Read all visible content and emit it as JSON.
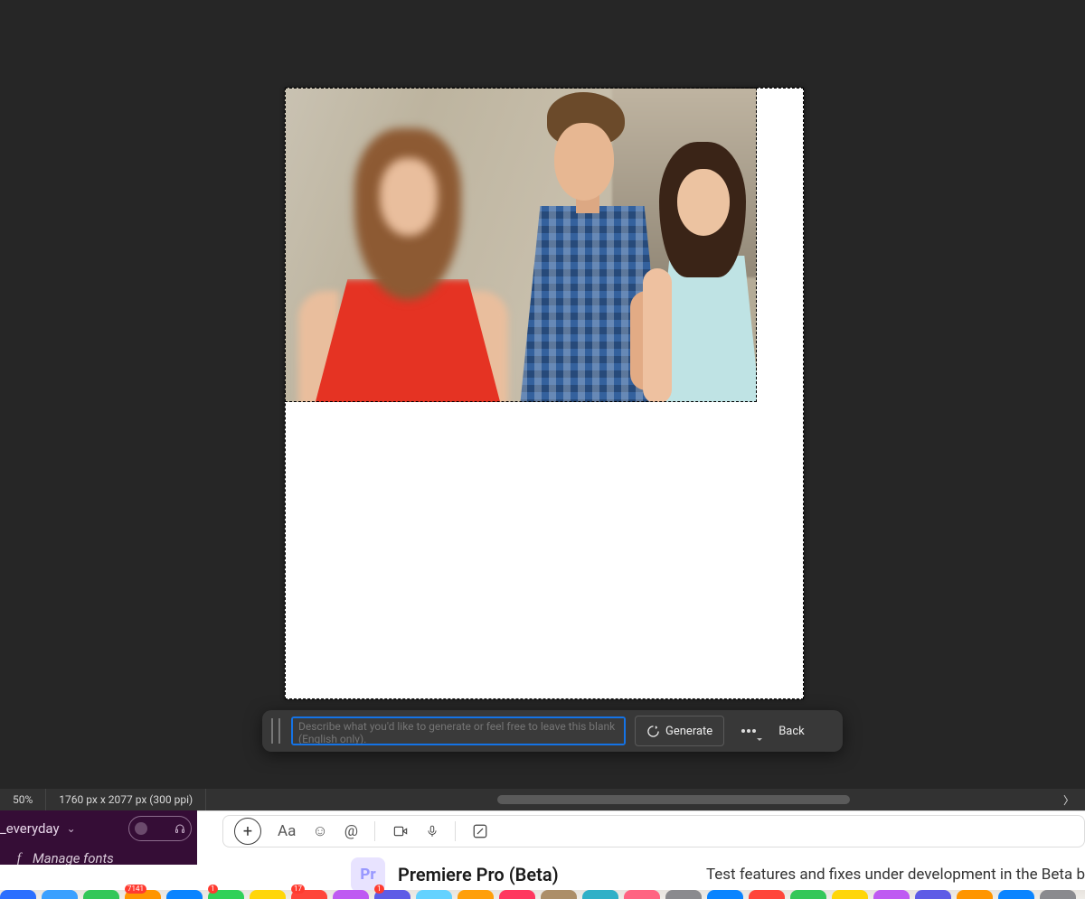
{
  "status": {
    "zoom": "50%",
    "dimensions": "1760 px x 2077 px (300 ppi)"
  },
  "genfill": {
    "placeholder": "Describe what you'd like to generate or feel free to leave this blank (English only).",
    "generate_label": "Generate",
    "back_label": "Back"
  },
  "slack": {
    "channel_label": "_everyday",
    "fonts_label": "Manage fonts"
  },
  "creative_cloud": {
    "app_abbrev": "Pr",
    "app_title": "Premiere Pro (Beta)",
    "app_desc": "Test features and fixes under development in the Beta b"
  },
  "dock_badges": [
    "7141",
    "1",
    "17",
    "1"
  ],
  "canvas_image": {
    "semantic": "distracted-boyfriend-meme-photo",
    "description": "Stock photo of a man turning to look at a woman in a red dress while his partner in a light-blue top looks on disapprovingly, on a blurred city street."
  }
}
